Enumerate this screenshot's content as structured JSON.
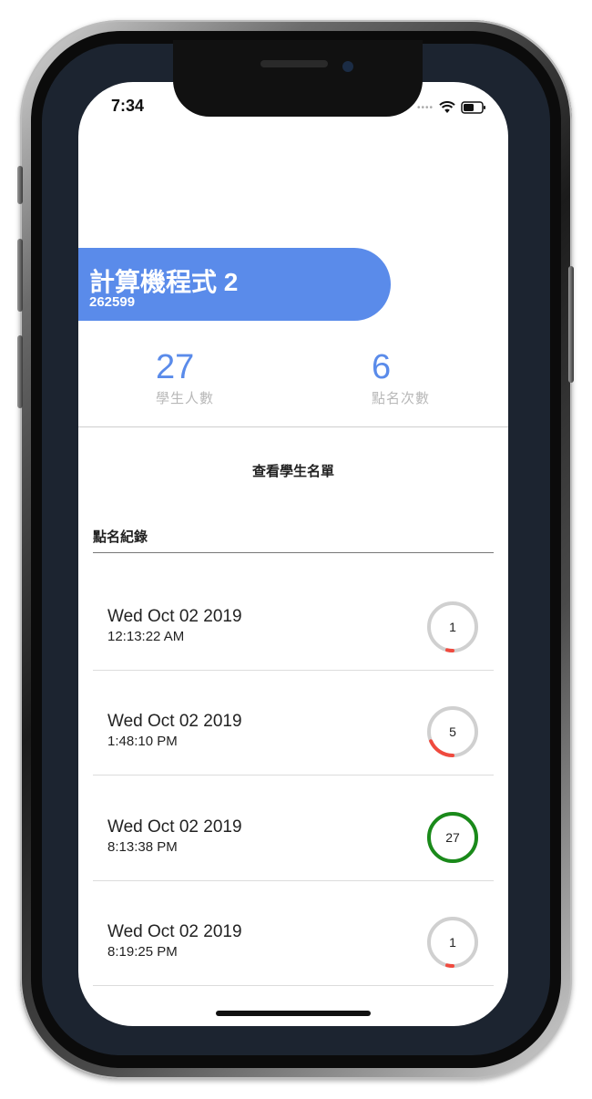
{
  "status_bar": {
    "time": "7:34"
  },
  "course": {
    "title": "計算機程式 2",
    "code": "262599"
  },
  "stats": [
    {
      "value": "27",
      "label": "學生人數"
    },
    {
      "value": "6",
      "label": "點名次數"
    }
  ],
  "actions": {
    "view_students": "查看學生名單"
  },
  "records_section": {
    "title": "點名紀錄"
  },
  "records": [
    {
      "date": "Wed Oct 02 2019",
      "time": "12:13:22 AM",
      "count": "1",
      "fraction": 0.037,
      "color": "#f04a3e"
    },
    {
      "date": "Wed Oct 02 2019",
      "time": "1:48:10 PM",
      "count": "5",
      "fraction": 0.185,
      "color": "#f04a3e"
    },
    {
      "date": "Wed Oct 02 2019",
      "time": "8:13:38 PM",
      "count": "27",
      "fraction": 1.0,
      "color": "#1a8a1a"
    },
    {
      "date": "Wed Oct 02 2019",
      "time": "8:19:25 PM",
      "count": "1",
      "fraction": 0.037,
      "color": "#f04a3e"
    }
  ],
  "colors": {
    "accent": "#5a8bea",
    "ring_track": "#d0d0d0"
  },
  "icons": [
    "wifi-icon",
    "battery-icon"
  ]
}
